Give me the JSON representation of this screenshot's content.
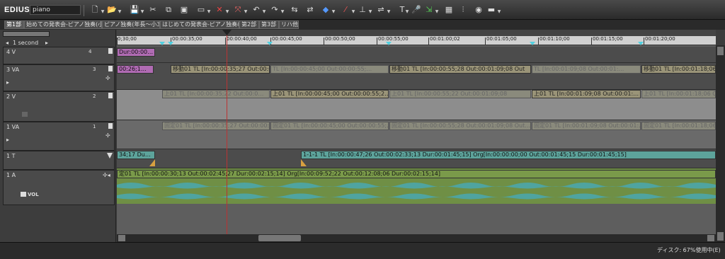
{
  "app": {
    "name": "EDIUS",
    "project": "piano"
  },
  "toolbar": {
    "icons": [
      "new-sequence-icon",
      "open-icon",
      "save-icon",
      "cut-icon",
      "copy-icon",
      "paste-icon",
      "clip-icon",
      "delete-icon",
      "ripple-delete-icon",
      "undo-icon",
      "redo-icon",
      "insert-icon",
      "overwrite-icon",
      "set-in-icon",
      "set-out-icon",
      "layout-icon",
      "title-icon",
      "audio-icon",
      "export-icon",
      "grid-icon",
      "mixer-icon",
      "record-icon",
      "window-icon"
    ]
  },
  "tabs": [
    "第1部",
    "始めての発表会-ピアノ独奏(小…",
    "ピアノ独奏(年長〜小3)",
    "はじめての発表会-ピアノ独奏&…",
    "第2部",
    "第3部",
    "リハ他"
  ],
  "active_tab": 0,
  "scale": {
    "label": "1 second"
  },
  "ruler": {
    "labels": [
      "0;30;00",
      "00:00:35;00",
      "00:00:40;00",
      "00:00:45;00",
      "00:00:50;00",
      "00:00:55;00",
      "00:01:00;02",
      "00:01:05;00",
      "00:01:10;00",
      "00:01:15;00",
      "00:01:20;00"
    ]
  },
  "tracks": {
    "v4": {
      "name": "4 V",
      "badge": "4"
    },
    "va3": {
      "name": "3 VA",
      "badge": "3"
    },
    "v2": {
      "name": "2 V",
      "badge": "2"
    },
    "va1": {
      "name": "1 VA",
      "badge": "1"
    },
    "t1": {
      "name": "1 T"
    },
    "a1": {
      "name": "1 A",
      "vol": "VOL"
    }
  },
  "clips": {
    "v4_left": "Dur:00:00…",
    "va3_left": "00:26;1…",
    "va3_a": "移動01  TL [In:00:00:35;27 Out:00:00:4",
    "va3_b": "TL [In:00:00:45;00 Out:00:00:55;…",
    "va3_c": "移動01  TL [In:00:00:55;28 Out:00:01:09;08 Out",
    "va3_d": "TL [In:00:01:09;08 Out:00:01:…",
    "va3_e": "移動01  TL [In:00:01:18;06 O",
    "v2_a": "上01  TL [In:00:00:35;22 Out:00:0…",
    "v2_b": "上01  TL [In:00:00:45;00 Out:00:00:55;2…",
    "v2_c": "上01  TL [In:00:00:55;22 Out:00:01:09;08",
    "v2_d": "上01  TL [In:00:01:09;08 Out:00:01:…",
    "v2_e": "上01  TL [In:00:01:18;06 O",
    "va1_a": "固定01  TL [In:00:00:35;27 Out:00:00:…",
    "va1_b": "固定01  TL [In:00:00:45;00 Out:00:00:55;…",
    "va1_c": "固定01  TL [In:00:00:55;28 Out:00:01:09;08 Out…",
    "va1_d": "固定01  TL [In:00:01:09;08 Out:00:01:…",
    "va1_e": "固定01  TL [In:00:01:18;06 O",
    "t1_a": "34;17 Du…",
    "t1_b": "1-1-1  TL [In:00:00:47;26 Out:00:02:33;13 Dur:00:01:45;15]  Org[In:00:00:00;00 Out:00:01:45;15 Dur:00:01:45;15]",
    "a1_a": "定01  TL [In:00:00:30;13 Out:00:02:45;27 Dur:00:02:15;14]  Org[In:00:09:52;22 Out:00:12:08;06 Dur:00:02:15;14]"
  },
  "status": {
    "disk": "ディスク: 67%使用中(E)"
  }
}
